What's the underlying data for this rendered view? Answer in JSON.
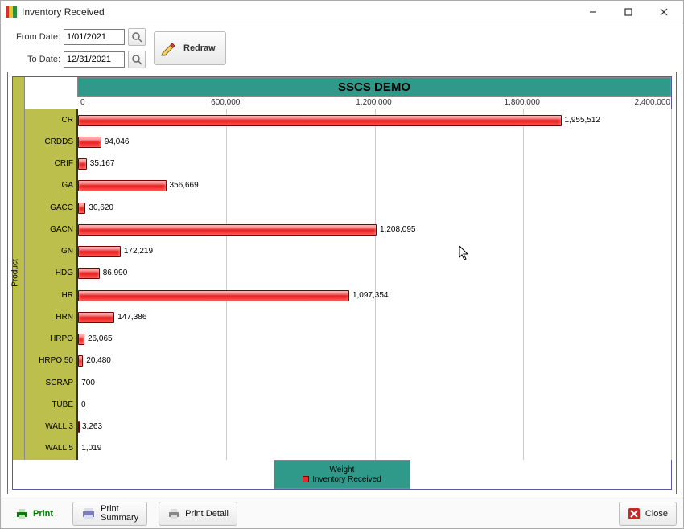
{
  "window": {
    "title": "Inventory Received"
  },
  "controls": {
    "from_label": "From Date:",
    "to_label": "To Date:",
    "from_value": "1/01/2021",
    "to_value": "12/31/2021",
    "redraw_label": "Redraw"
  },
  "footer": {
    "print": "Print",
    "print_summary_l1": "Print",
    "print_summary_l2": "Summary",
    "print_detail": "Print Detail",
    "close": "Close"
  },
  "chart_data": {
    "type": "bar",
    "orientation": "horizontal",
    "title": "SSCS DEMO",
    "ylabel": "Product",
    "xlabel": "Weight",
    "legend": [
      "Inventory Received"
    ],
    "xlim": [
      0,
      2400000
    ],
    "xticks": [
      0,
      600000,
      1200000,
      1800000,
      2400000
    ],
    "xtick_labels": [
      "0",
      "600,000",
      "1,200,000",
      "1,800,000",
      "2,400,000"
    ],
    "categories": [
      "CR",
      "CRDDS",
      "CRIF",
      "GA",
      "GACC",
      "GACN",
      "GN",
      "HDG",
      "HR",
      "HRN",
      "HRPO",
      "HRPO 50",
      "SCRAP",
      "TUBE",
      "WALL 3",
      "WALL 5"
    ],
    "values": [
      1955512,
      94046,
      35167,
      356669,
      30620,
      1208095,
      172219,
      86990,
      1097354,
      147386,
      26065,
      20480,
      700,
      0,
      3263,
      1019
    ],
    "value_labels": [
      "1,955,512",
      "94,046",
      "35,167",
      "356,669",
      "30,620",
      "1,208,095",
      "172,219",
      "86,990",
      "1,097,354",
      "147,386",
      "26,065",
      "20,480",
      "700",
      "0",
      "3,263",
      "1,019"
    ]
  }
}
